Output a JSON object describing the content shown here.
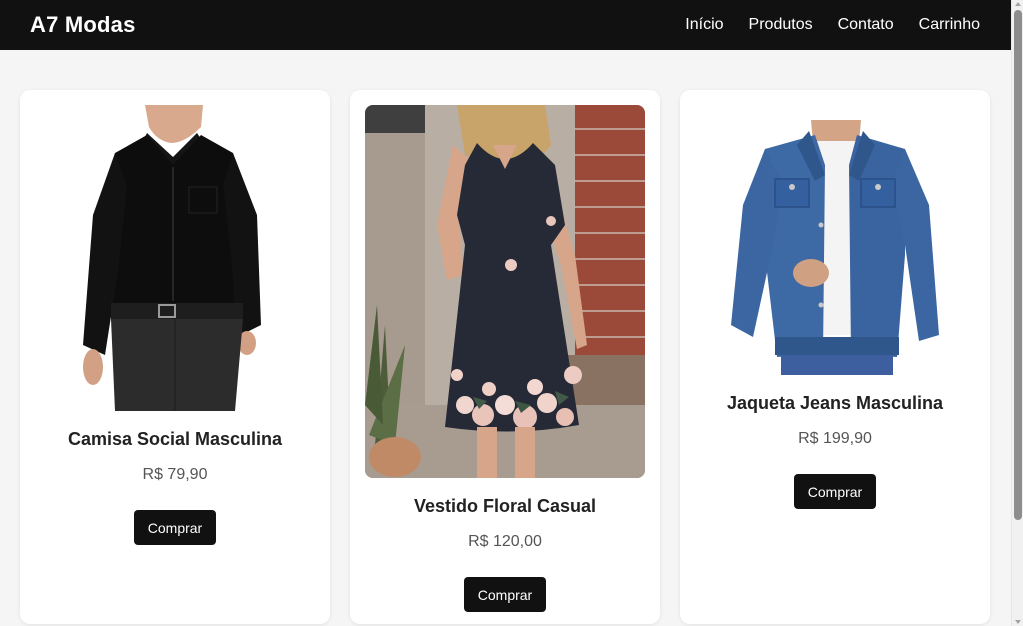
{
  "header": {
    "logo": "A7 Modas",
    "nav": [
      "Início",
      "Produtos",
      "Contato",
      "Carrinho"
    ],
    "background": "#111111"
  },
  "products": [
    {
      "name": "Camisa Social Masculina",
      "price": "R$ 79,90",
      "button": "Comprar",
      "image": "black-dress-shirt-photo"
    },
    {
      "name": "Vestido Floral Casual",
      "price": "R$ 120,00",
      "button": "Comprar",
      "image": "floral-dress-photo"
    },
    {
      "name": "Jaqueta Jeans Masculina",
      "price": "R$ 199,90",
      "button": "Comprar",
      "image": "denim-jacket-photo"
    }
  ],
  "colors": {
    "accent": "#111111",
    "page_bg": "#f5f5f5",
    "card_bg": "#ffffff"
  }
}
